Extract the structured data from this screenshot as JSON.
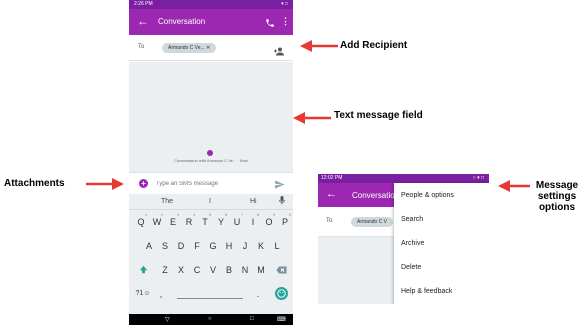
{
  "phone_main": {
    "status_time": "2:26 PM",
    "status_icons": "▾ □",
    "appbar": {
      "back_icon": "back-arrow-icon",
      "title": "Conversation",
      "phone_icon": "phone-icon",
      "more_icon": "more-vert-icon"
    },
    "to_label": "To",
    "recipient_chip": "Armando C Ve...",
    "conversation_caption": "Conversation with Armando C Ve... · Now",
    "compose": {
      "placeholder": "Type an SMS message",
      "send_label": "SMS"
    },
    "keyboard": {
      "suggestions": [
        "The",
        "I",
        "Hi"
      ],
      "row1": [
        "Q",
        "W",
        "E",
        "R",
        "T",
        "Y",
        "U",
        "I",
        "O",
        "P"
      ],
      "row1_hints": [
        "1",
        "2",
        "3",
        "4",
        "5",
        "6",
        "7",
        "8",
        "9",
        "0"
      ],
      "row2": [
        "A",
        "S",
        "D",
        "F",
        "G",
        "H",
        "J",
        "K",
        "L"
      ],
      "row3": [
        "Z",
        "X",
        "C",
        "V",
        "B",
        "N",
        "M"
      ],
      "symbols_key": "?1☺",
      "comma_key": ",",
      "period_key": "."
    }
  },
  "phone_menu": {
    "status_time": "12:02 PM",
    "status_icons": "○ ▾ □",
    "appbar_title": "Conversatio",
    "to_label": "To",
    "recipient_chip": "Armando C V",
    "menu_items": [
      "People & options",
      "Search",
      "Archive",
      "Delete",
      "Help & feedback"
    ]
  },
  "annotations": {
    "add_recipient": "Add Recipient",
    "text_message_field": "Text message field",
    "attachments": "Attachments",
    "settings_line1": "Message",
    "settings_line2": "settings",
    "settings_line3": "options"
  },
  "colors": {
    "appbar": "#9c27b0",
    "statusbar": "#7b1fa2",
    "annotation_arrow": "#e53935"
  }
}
